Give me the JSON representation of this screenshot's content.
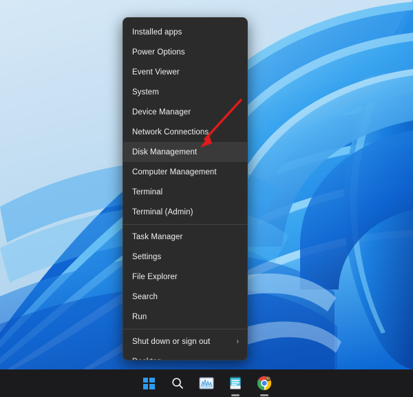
{
  "desktop": {
    "wallpaper_name": "windows-11-bloom-wallpaper",
    "gradient_top_color": "#cfe2f2",
    "gradient_bottom_color": "#0a4fbf",
    "ribbon_light_color": "#6fc3f5",
    "ribbon_mid_color": "#1e8fe8",
    "ribbon_deep_color": "#0a53c8"
  },
  "context_menu": {
    "name": "power-user-menu",
    "background_color": "#2b2b2b",
    "highlight_color": "#3a3a3a",
    "text_color": "#f0f0f0",
    "items": [
      {
        "label": "Installed apps",
        "name": "installed-apps",
        "highlighted": false,
        "submenu": false,
        "separator_after": false
      },
      {
        "label": "Power Options",
        "name": "power-options",
        "highlighted": false,
        "submenu": false,
        "separator_after": false
      },
      {
        "label": "Event Viewer",
        "name": "event-viewer",
        "highlighted": false,
        "submenu": false,
        "separator_after": false
      },
      {
        "label": "System",
        "name": "system",
        "highlighted": false,
        "submenu": false,
        "separator_after": false
      },
      {
        "label": "Device Manager",
        "name": "device-manager",
        "highlighted": false,
        "submenu": false,
        "separator_after": false
      },
      {
        "label": "Network Connections",
        "name": "network-connections",
        "highlighted": false,
        "submenu": false,
        "separator_after": false
      },
      {
        "label": "Disk Management",
        "name": "disk-management",
        "highlighted": true,
        "submenu": false,
        "separator_after": false
      },
      {
        "label": "Computer Management",
        "name": "computer-management",
        "highlighted": false,
        "submenu": false,
        "separator_after": false
      },
      {
        "label": "Terminal",
        "name": "terminal",
        "highlighted": false,
        "submenu": false,
        "separator_after": false
      },
      {
        "label": "Terminal (Admin)",
        "name": "terminal-admin",
        "highlighted": false,
        "submenu": false,
        "separator_after": true
      },
      {
        "label": "Task Manager",
        "name": "task-manager",
        "highlighted": false,
        "submenu": false,
        "separator_after": false
      },
      {
        "label": "Settings",
        "name": "settings",
        "highlighted": false,
        "submenu": false,
        "separator_after": false
      },
      {
        "label": "File Explorer",
        "name": "file-explorer",
        "highlighted": false,
        "submenu": false,
        "separator_after": false
      },
      {
        "label": "Search",
        "name": "search",
        "highlighted": false,
        "submenu": false,
        "separator_after": false
      },
      {
        "label": "Run",
        "name": "run",
        "highlighted": false,
        "submenu": false,
        "separator_after": true
      },
      {
        "label": "Shut down or sign out",
        "name": "shut-down-or-sign-out",
        "highlighted": false,
        "submenu": true,
        "separator_after": false
      },
      {
        "label": "Desktop",
        "name": "desktop",
        "highlighted": false,
        "submenu": false,
        "separator_after": false
      }
    ],
    "submenu_chevron_glyph": "›"
  },
  "annotation": {
    "name": "red-arrow-pointing-to-disk-management",
    "color": "#e01b1b",
    "points_to": "Disk Management"
  },
  "taskbar": {
    "background_color": "#1b1b1e",
    "items": [
      {
        "name": "start-button",
        "icon": "windows-logo-icon",
        "label": "Start",
        "running": false
      },
      {
        "name": "search-button",
        "icon": "search-icon",
        "label": "Search",
        "running": false
      },
      {
        "name": "task-manager-button",
        "icon": "task-manager-icon",
        "label": "Task Manager",
        "running": false
      },
      {
        "name": "notepad-button",
        "icon": "notepad-icon",
        "label": "Notepad",
        "running": true
      },
      {
        "name": "chrome-button",
        "icon": "google-chrome-icon",
        "label": "Google Chrome",
        "running": true
      }
    ]
  }
}
